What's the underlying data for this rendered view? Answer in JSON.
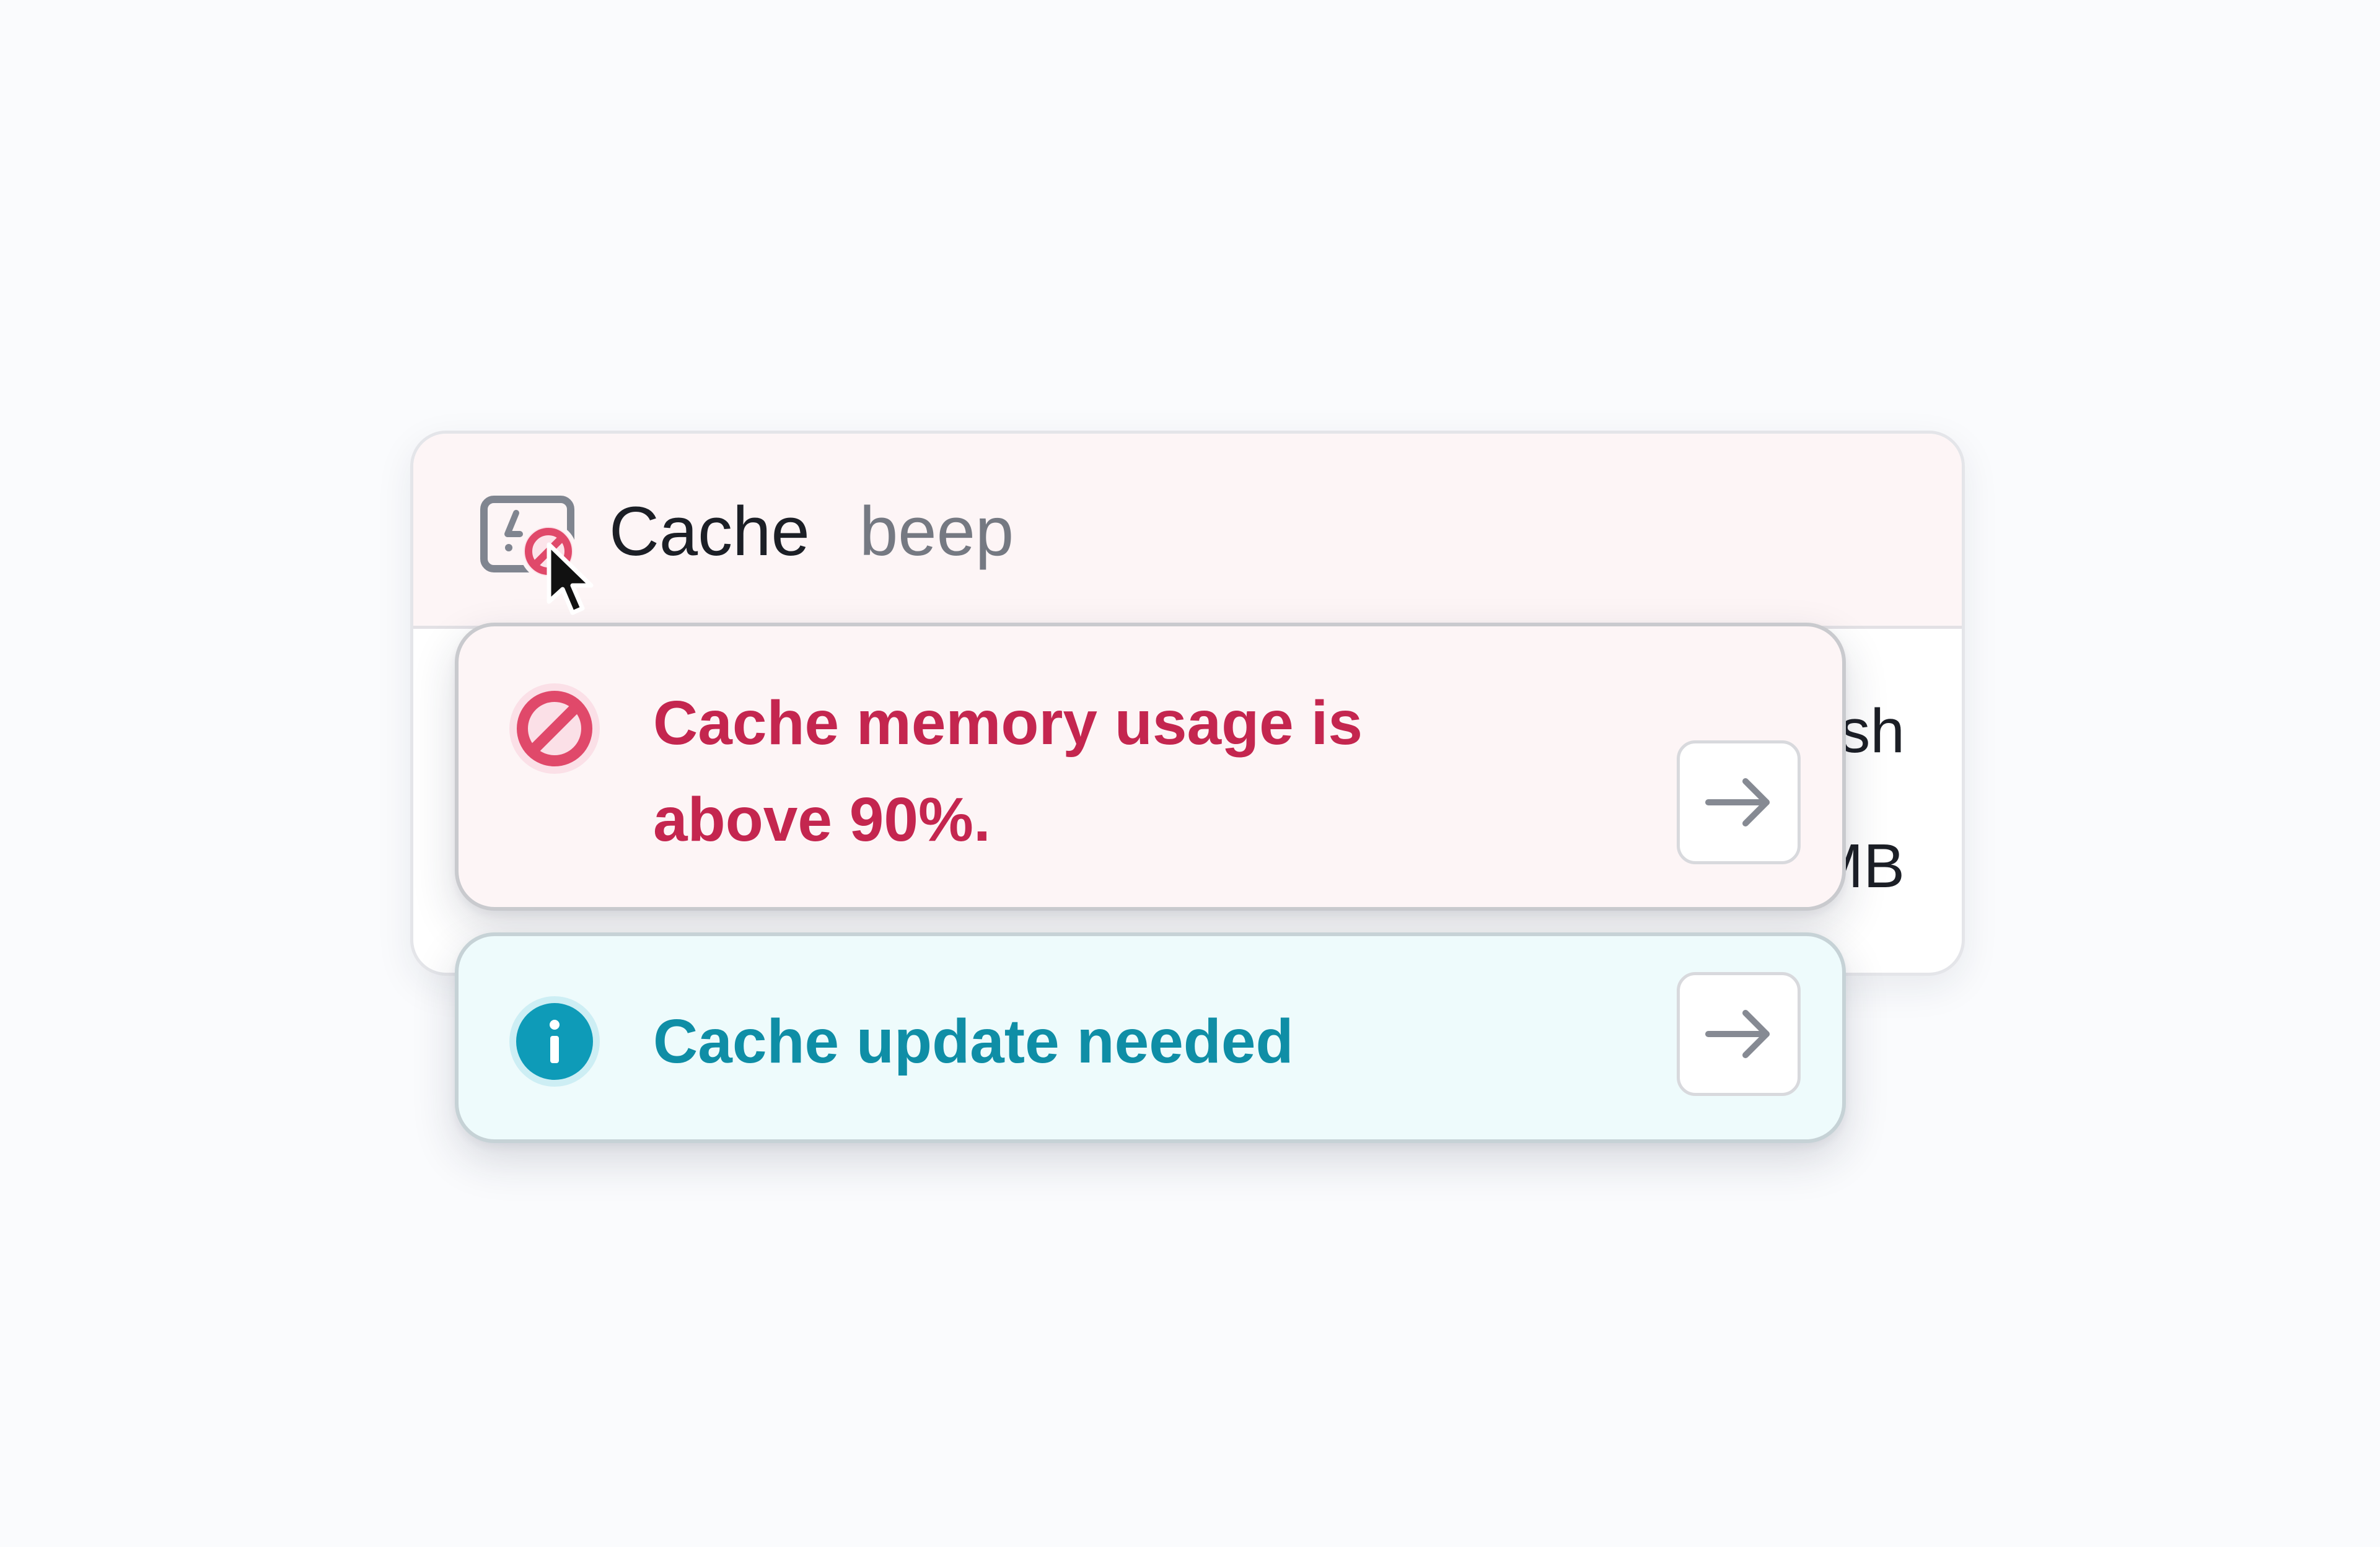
{
  "cache_card": {
    "title": "Cache",
    "subtitle": "beep",
    "icon": "cache-error-icon",
    "row_1_text": "sh",
    "row_2_text": "MB"
  },
  "alerts": [
    {
      "type": "error",
      "icon": "prohibited-icon",
      "line_1": "Cache memory usage is",
      "line_2": "above 90%.",
      "action_icon": "arrow-right-icon"
    },
    {
      "type": "info",
      "icon": "info-icon",
      "text": "Cache update needed",
      "action_icon": "arrow-right-icon"
    }
  ],
  "colors": {
    "background": "#fafbfd",
    "header_background": "#fdf5f6",
    "error_text": "#c4264f",
    "error_icon": "#e0496a",
    "info_background": "#eefbfc",
    "info_text": "#0f8ea6",
    "info_icon": "#0e9bb8",
    "muted_text": "#757982"
  }
}
